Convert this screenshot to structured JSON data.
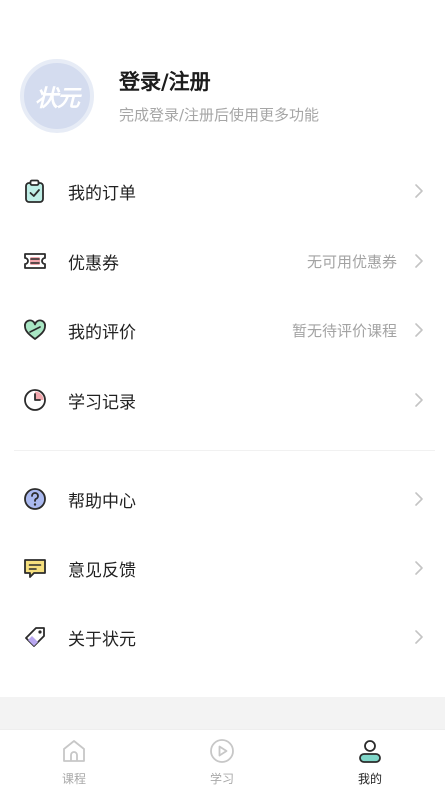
{
  "profile": {
    "avatar_text": "状元",
    "title": "登录/注册",
    "subtitle": "完成登录/注册后使用更多功能"
  },
  "menu": [
    {
      "label": "我的订单",
      "value": "",
      "icon": "clipboard-check-icon"
    },
    {
      "label": "优惠券",
      "value": "无可用优惠券",
      "icon": "ticket-icon"
    },
    {
      "label": "我的评价",
      "value": "暂无待评价课程",
      "icon": "heart-icon"
    },
    {
      "label": "学习记录",
      "value": "",
      "icon": "clock-icon"
    },
    {
      "label": "帮助中心",
      "value": "",
      "icon": "help-circle-icon"
    },
    {
      "label": "意见反馈",
      "value": "",
      "icon": "message-feedback-icon"
    },
    {
      "label": "关于状元",
      "value": "",
      "icon": "tag-icon"
    }
  ],
  "tabs": [
    {
      "label": "课程",
      "icon": "home-icon",
      "active": false
    },
    {
      "label": "学习",
      "icon": "play-circle-icon",
      "active": false
    },
    {
      "label": "我的",
      "icon": "user-icon",
      "active": true
    }
  ],
  "colors": {
    "avatar_bg": "#d4dcef",
    "accent_teal": "#7fd6c8",
    "accent_pink": "#f2a7ad",
    "accent_purple": "#b9a7f0",
    "accent_yellow": "#f5df7e",
    "accent_blue": "#aab9ef"
  }
}
